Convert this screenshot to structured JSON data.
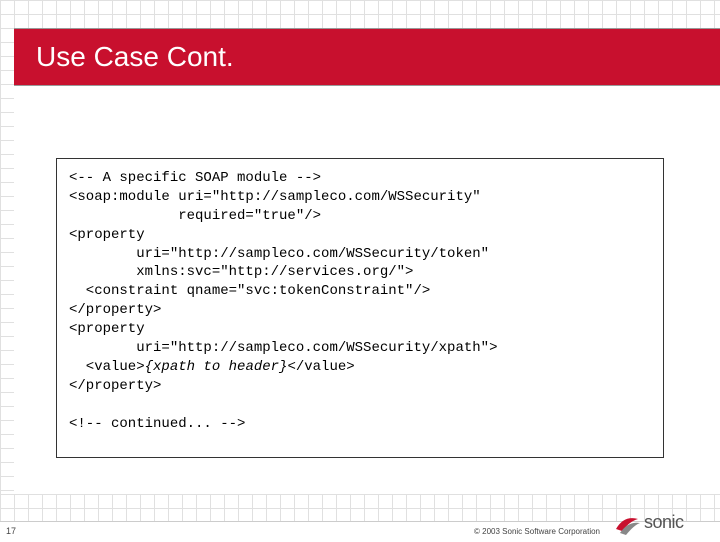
{
  "title": "Use Case Cont.",
  "code": {
    "l1": "<-- A specific SOAP module -->",
    "l2": "<soap:module uri=\"http://sampleco.com/WSSecurity\"",
    "l3": "             required=\"true\"/>",
    "l4": "<property",
    "l5": "        uri=\"http://sampleco.com/WSSecurity/token\"",
    "l6": "        xmlns:svc=\"http://services.org/\">",
    "l7": "  <constraint qname=\"svc:tokenConstraint\"/>",
    "l8": "</property>",
    "l9": "<property",
    "l10": "        uri=\"http://sampleco.com/WSSecurity/xpath\">",
    "l11a": "  <value>",
    "l11b": "{xpath to header}",
    "l11c": "</value>",
    "l12": "</property>",
    "l13": "",
    "l14": "<!-- continued... -->"
  },
  "footer": {
    "page": "17",
    "copyright": "© 2003 Sonic Software Corporation",
    "logo_text": "sonic"
  }
}
